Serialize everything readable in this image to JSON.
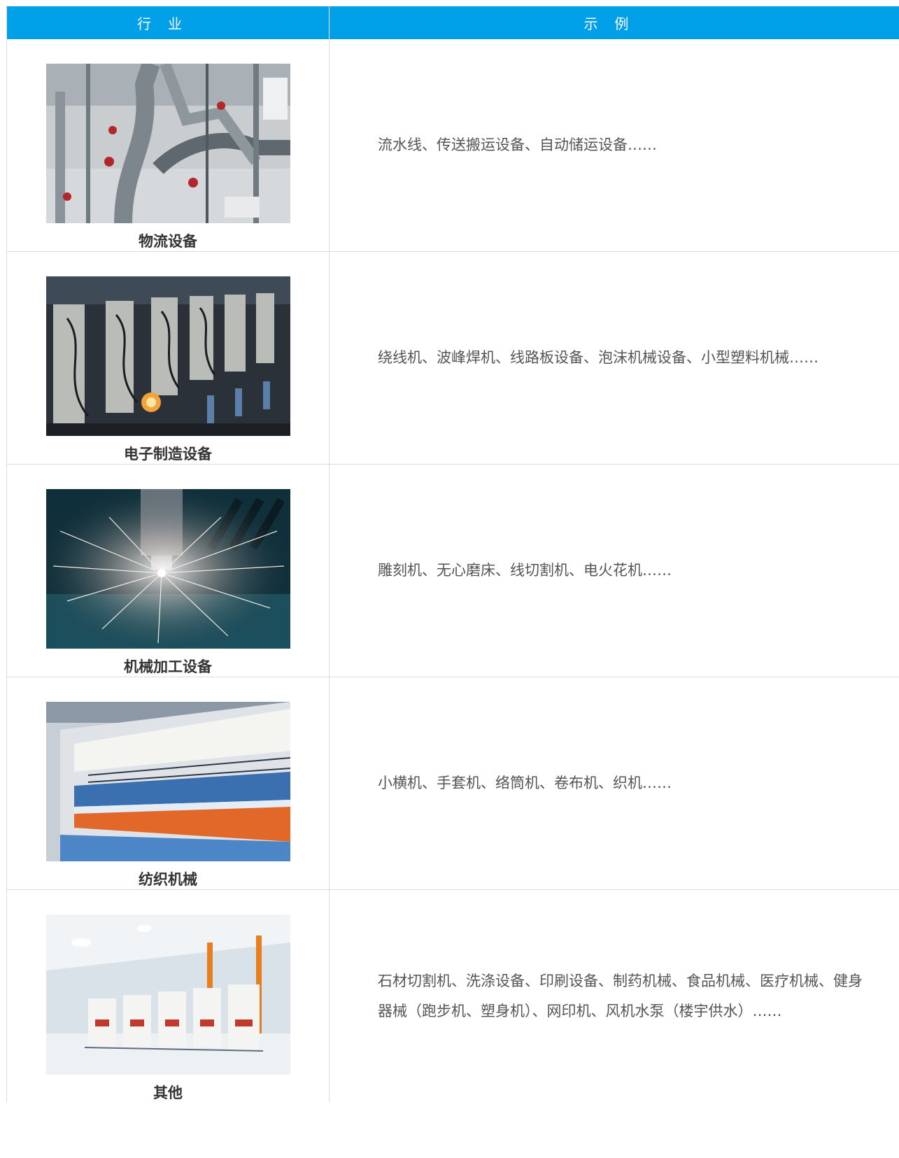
{
  "table": {
    "header": {
      "industry": "行业",
      "example": "示例"
    },
    "rows": [
      {
        "industry": "物流设备",
        "example": "流水线、传送搬运设备、自动储运设备……",
        "image": "conveyor-line-photo"
      },
      {
        "industry": "电子制造设备",
        "example": "绕线机、波峰焊机、线路板设备、泡沫机械设备、小型塑料机械……",
        "image": "winding-machines-photo"
      },
      {
        "industry": "机械加工设备",
        "example": "雕刻机、无心磨床、线切割机、电火花机……",
        "image": "laser-cutting-sparks-photo"
      },
      {
        "industry": "纺织机械",
        "example": "小横机、手套机、络筒机、卷布机、织机……",
        "image": "spinning-frame-photo"
      },
      {
        "industry": "其他",
        "example": "石材切割机、洗涤设备、印刷设备、制药机械、食品机械、医疗机械、健身器械（跑步机、塑身机）、网印机、风机水泵（楼宇供水）……",
        "image": "printing-press-photo"
      }
    ]
  },
  "colors": {
    "header_bg": "#00a0e9",
    "header_text": "#ffffff",
    "border": "#dcdcdc",
    "body_text": "#555555"
  }
}
